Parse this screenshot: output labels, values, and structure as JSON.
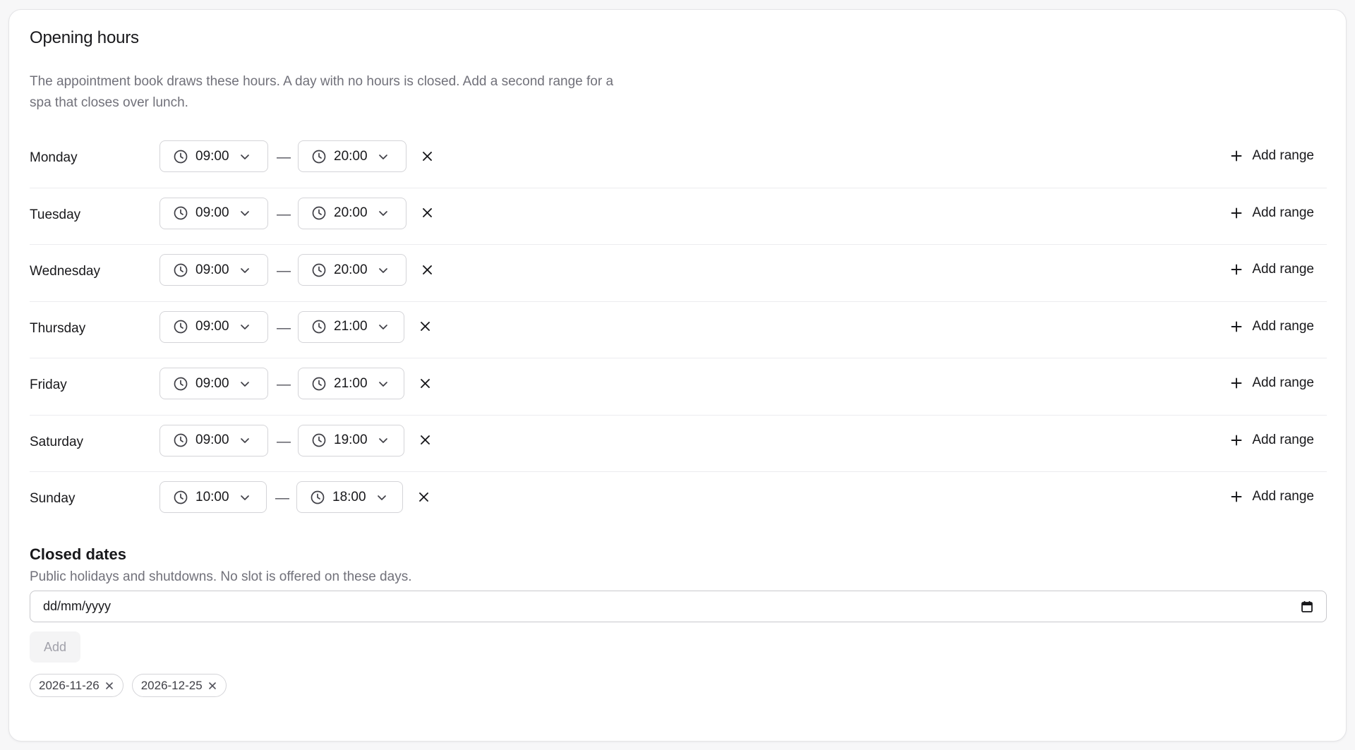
{
  "page": {
    "title": "Opening hours",
    "description": "The appointment book draws these hours. A day with no hours is closed. Add a second range for a spa that closes over lunch."
  },
  "hours": {
    "dash": "—",
    "add_range_label": "Add range",
    "days": [
      {
        "day": "Monday",
        "open": "09:00",
        "close": "20:00"
      },
      {
        "day": "Tuesday",
        "open": "09:00",
        "close": "20:00"
      },
      {
        "day": "Wednesday",
        "open": "09:00",
        "close": "20:00"
      },
      {
        "day": "Thursday",
        "open": "09:00",
        "close": "21:00"
      },
      {
        "day": "Friday",
        "open": "09:00",
        "close": "21:00"
      },
      {
        "day": "Saturday",
        "open": "09:00",
        "close": "19:00"
      },
      {
        "day": "Sunday",
        "open": "10:00",
        "close": "18:00"
      }
    ]
  },
  "closed_dates": {
    "title": "Closed dates",
    "description": "Public holidays and shutdowns. No slot is offered on these days.",
    "input_placeholder": "dd/mm/yyyy",
    "add_label": "Add",
    "dates": [
      "2026-11-26",
      "2026-12-25"
    ]
  },
  "icons": {
    "clock": "clock-icon",
    "chevron": "chevron-down-icon",
    "remove": "close-icon",
    "add": "plus-icon",
    "calendar": "calendar-icon"
  },
  "colors": {
    "text": "#18181b",
    "muted": "#71717a",
    "border": "#d4d4d8",
    "disabled_bg": "#f4f4f5"
  }
}
